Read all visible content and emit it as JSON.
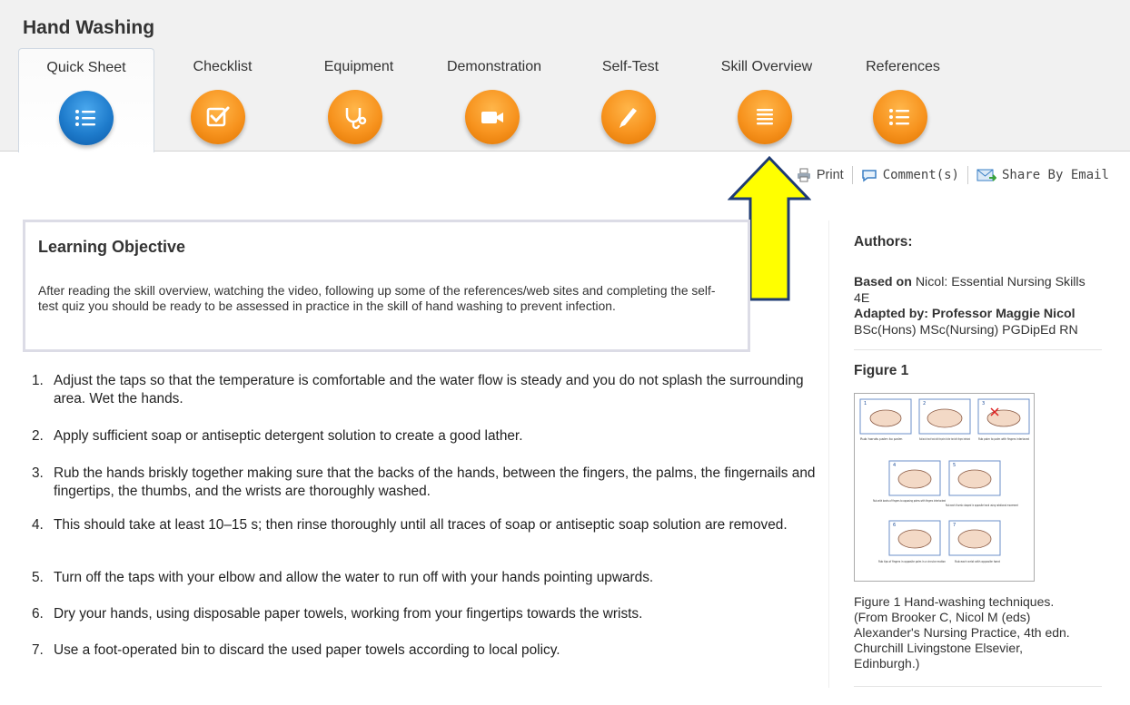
{
  "page": {
    "title": "Hand Washing"
  },
  "tabs": [
    {
      "label": "Quick Sheet",
      "icon": "list-icon",
      "active": true
    },
    {
      "label": "Checklist",
      "icon": "checkbox-icon"
    },
    {
      "label": "Equipment",
      "icon": "stethoscope-icon"
    },
    {
      "label": "Demonstration",
      "icon": "video-camera-icon"
    },
    {
      "label": "Self-Test",
      "icon": "pencil-icon"
    },
    {
      "label": "Skill Overview",
      "icon": "document-lines-icon"
    },
    {
      "label": "References",
      "icon": "list-icon"
    }
  ],
  "actions": {
    "print": "Print",
    "comments": "Comment(s)",
    "share": "Share By Email"
  },
  "objective": {
    "heading": "Learning Objective",
    "text": "After reading the skill overview, watching the video, following up some of the references/web sites and completing the self-test quiz you should be ready to be assessed in practice in the skill of hand washing to prevent infection."
  },
  "steps": [
    {
      "num": "1.",
      "text": "Adjust the taps so that the temperature is comfortable and the water flow is steady and you do not splash the surrounding area. Wet the hands."
    },
    {
      "num": "2.",
      "text": "Apply sufficient soap or antiseptic detergent solution to create a good lather."
    },
    {
      "num": "3.",
      "text": "Rub the hands briskly together making sure that the backs of the hands, between the fingers, the palms, the fingernails and fingertips, the thumbs, and the wrists are thoroughly washed."
    },
    {
      "num": "4.",
      "text": "This should take at least 10–15 s; then rinse thoroughly until all traces of soap or antiseptic soap solution are removed."
    },
    {
      "num": "5.",
      "text": "Turn off the taps with your elbow and allow the water to run off with your hands pointing upwards."
    },
    {
      "num": "6.",
      "text": "Dry your hands, using disposable paper towels, working from your fingertips towards the wrists."
    },
    {
      "num": "7.",
      "text": "Use a foot-operated bin to discard the used paper towels according to local policy."
    }
  ],
  "sidebar": {
    "authors_heading": "Authors:",
    "based_on_label": "Based on",
    "based_on_value": "Nicol: Essential Nursing Skills 4E",
    "adapted_label": "Adapted by: Professor Maggie Nicol",
    "adapted_value": "BSc(Hons) MSc(Nursing) PGDipEd RN",
    "figure_heading": "Figure 1",
    "figure_caption": "Figure 1 Hand-washing techniques. (From Brooker C, Nicol M (eds) Alexander's Nursing Practice, 4th edn. Churchill Livingstone Elsevier, Edinburgh.)",
    "figure_panels": [
      "Rub hands palm to palm",
      "Rub back of each hand with the palm of other hand with fingers interlaced",
      "Rub palm to palm with fingers interlaced",
      "Rub with backs of fingers to opposing palms with fingers interlocked",
      "Rub each thumb clasped in opposite hand using rotational movement",
      "Rub tips of fingers in opposite palm in a circular motion",
      "Rub each wrist with opposite hand"
    ]
  },
  "colors": {
    "accent_orange": "#f7931e",
    "accent_blue": "#1f7ccc",
    "highlight_arrow": "#ffff00",
    "arrow_outline": "#1f3b73"
  }
}
